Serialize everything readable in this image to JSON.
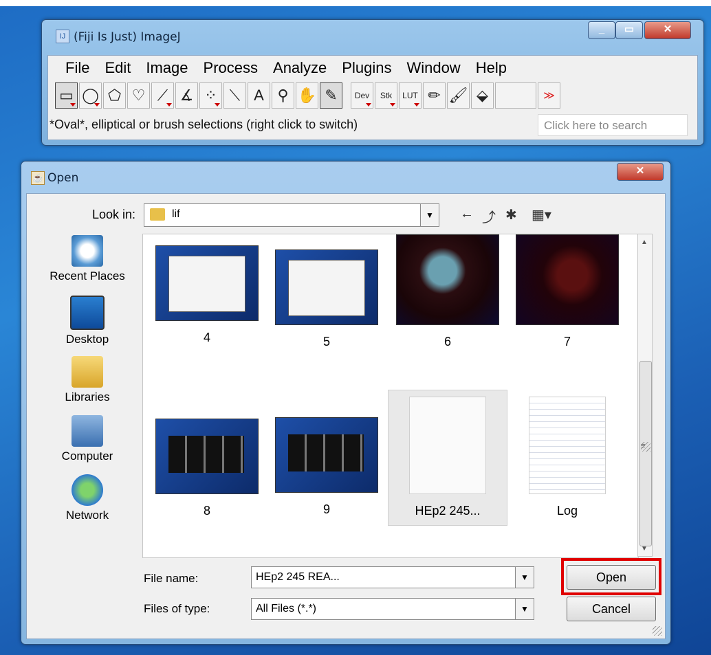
{
  "imagej": {
    "title": "(Fiji Is Just) ImageJ",
    "menu": [
      "File",
      "Edit",
      "Image",
      "Process",
      "Analyze",
      "Plugins",
      "Window",
      "Help"
    ],
    "tools": [
      {
        "name": "rectangle-tool",
        "glyph": "▭"
      },
      {
        "name": "oval-tool",
        "glyph": "◯"
      },
      {
        "name": "polygon-tool",
        "glyph": "⬠"
      },
      {
        "name": "freehand-tool",
        "glyph": "♡"
      },
      {
        "name": "line-tool",
        "glyph": "⟋"
      },
      {
        "name": "angle-tool",
        "glyph": "∡"
      },
      {
        "name": "point-tool",
        "glyph": "⁘"
      },
      {
        "name": "wand-tool",
        "glyph": "⟍"
      },
      {
        "name": "text-tool",
        "glyph": "A"
      },
      {
        "name": "magnifier-tool",
        "glyph": "⚲"
      },
      {
        "name": "hand-tool",
        "glyph": "✋"
      },
      {
        "name": "dropper-tool",
        "glyph": "✎"
      },
      {
        "name": "dev-tool",
        "glyph": "Dev"
      },
      {
        "name": "stk-tool",
        "glyph": "Stk"
      },
      {
        "name": "lut-tool",
        "glyph": "LUT"
      },
      {
        "name": "pencil-tool",
        "glyph": "✏"
      },
      {
        "name": "brush-tool",
        "glyph": "🖌"
      },
      {
        "name": "flood-fill-tool",
        "glyph": "⬙"
      },
      {
        "name": "empty-tool",
        "glyph": ""
      },
      {
        "name": "more-tools",
        "glyph": "≫"
      }
    ],
    "status": "*Oval*, elliptical or brush selections (right click to switch)",
    "search_placeholder": "Click here to search"
  },
  "dialog": {
    "title": "Open",
    "look_in_label": "Look in:",
    "look_in_value": "lif",
    "places": [
      "Recent Places",
      "Desktop",
      "Libraries",
      "Computer",
      "Network"
    ],
    "files": [
      {
        "name": "4"
      },
      {
        "name": "5"
      },
      {
        "name": "6"
      },
      {
        "name": "7"
      },
      {
        "name": "8"
      },
      {
        "name": "9"
      },
      {
        "name": "HEp2 245..."
      },
      {
        "name": "Log"
      }
    ],
    "file_name_label": "File name:",
    "file_name_value": "HEp2 245 REA...",
    "files_of_type_label": "Files of type:",
    "files_of_type_value": "All Files (*.*)",
    "open_label": "Open",
    "cancel_label": "Cancel"
  },
  "colors": {
    "highlight": "#e00000",
    "desktop": "#1e6cc4"
  }
}
